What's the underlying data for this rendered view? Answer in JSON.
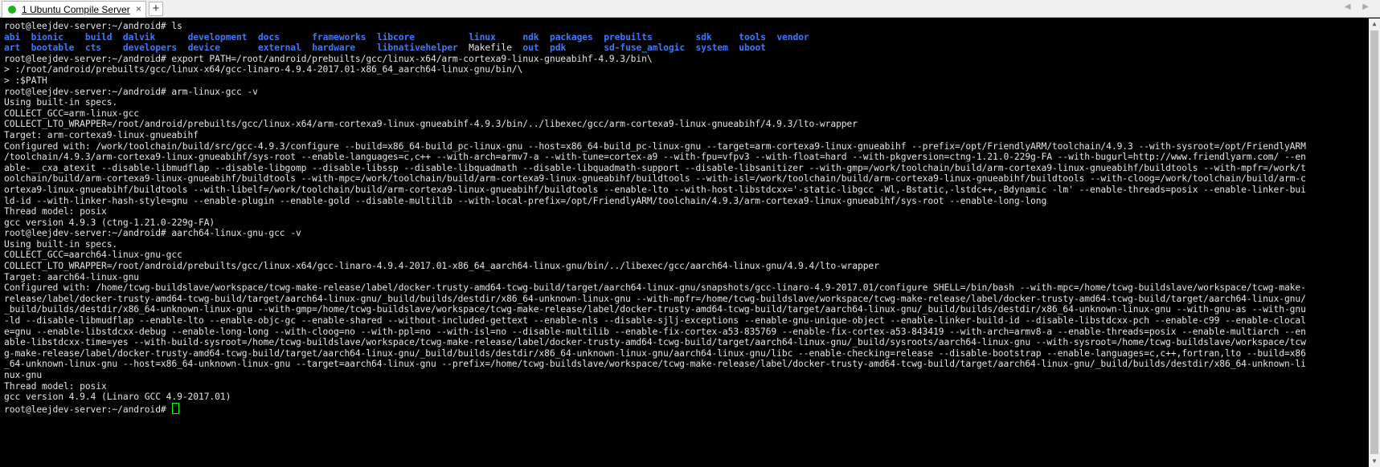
{
  "window": {
    "tab_title": "1 Ubuntu Compile Server",
    "tab_close": "×",
    "new_tab": "+",
    "nav_arrows": "◀ ▶"
  },
  "terminal": {
    "lines": [
      [
        {
          "t": "root@leejdev-server:~/android# ls"
        }
      ],
      [
        {
          "t": "abi",
          "c": "dir"
        },
        {
          "t": "  "
        },
        {
          "t": "bionic",
          "c": "dir"
        },
        {
          "t": "    "
        },
        {
          "t": "build",
          "c": "dir"
        },
        {
          "t": "  "
        },
        {
          "t": "dalvik",
          "c": "dir"
        },
        {
          "t": "      "
        },
        {
          "t": "development",
          "c": "dir"
        },
        {
          "t": "  "
        },
        {
          "t": "docs",
          "c": "dir"
        },
        {
          "t": "      "
        },
        {
          "t": "frameworks",
          "c": "dir"
        },
        {
          "t": "  "
        },
        {
          "t": "libcore",
          "c": "dir"
        },
        {
          "t": "          "
        },
        {
          "t": "linux",
          "c": "dir"
        },
        {
          "t": "     "
        },
        {
          "t": "ndk",
          "c": "dir"
        },
        {
          "t": "  "
        },
        {
          "t": "packages",
          "c": "dir"
        },
        {
          "t": "  "
        },
        {
          "t": "prebuilts",
          "c": "dir"
        },
        {
          "t": "        "
        },
        {
          "t": "sdk",
          "c": "dir"
        },
        {
          "t": "     "
        },
        {
          "t": "tools",
          "c": "dir"
        },
        {
          "t": "  "
        },
        {
          "t": "vendor",
          "c": "dir"
        }
      ],
      [
        {
          "t": "art",
          "c": "dir"
        },
        {
          "t": "  "
        },
        {
          "t": "bootable",
          "c": "dir"
        },
        {
          "t": "  "
        },
        {
          "t": "cts",
          "c": "dir"
        },
        {
          "t": "    "
        },
        {
          "t": "developers",
          "c": "dir"
        },
        {
          "t": "  "
        },
        {
          "t": "device",
          "c": "dir"
        },
        {
          "t": "       "
        },
        {
          "t": "external",
          "c": "dir"
        },
        {
          "t": "  "
        },
        {
          "t": "hardware",
          "c": "dir"
        },
        {
          "t": "    "
        },
        {
          "t": "libnativehelper",
          "c": "dir"
        },
        {
          "t": "  Makefile  "
        },
        {
          "t": "out",
          "c": "dir"
        },
        {
          "t": "  "
        },
        {
          "t": "pdk",
          "c": "dir"
        },
        {
          "t": "       "
        },
        {
          "t": "sd-fuse_amlogic",
          "c": "dir"
        },
        {
          "t": "  "
        },
        {
          "t": "system",
          "c": "dir"
        },
        {
          "t": "  "
        },
        {
          "t": "uboot",
          "c": "dir"
        }
      ],
      [
        {
          "t": "root@leejdev-server:~/android# export PATH=/root/android/prebuilts/gcc/linux-x64/arm-cortexa9-linux-gnueabihf-4.9.3/bin\\"
        }
      ],
      [
        {
          "t": "> :/root/android/prebuilts/gcc/linux-x64/gcc-linaro-4.9.4-2017.01-x86_64_aarch64-linux-gnu/bin/\\"
        }
      ],
      [
        {
          "t": "> :$PATH"
        }
      ],
      [
        {
          "t": "root@leejdev-server:~/android# arm-linux-gcc -v"
        }
      ],
      [
        {
          "t": "Using built-in specs."
        }
      ],
      [
        {
          "t": "COLLECT_GCC=arm-linux-gcc"
        }
      ],
      [
        {
          "t": "COLLECT_LTO_WRAPPER=/root/android/prebuilts/gcc/linux-x64/arm-cortexa9-linux-gnueabihf-4.9.3/bin/../libexec/gcc/arm-cortexa9-linux-gnueabihf/4.9.3/lto-wrapper"
        }
      ],
      [
        {
          "t": "Target: arm-cortexa9-linux-gnueabihf"
        }
      ],
      [
        {
          "t": "Configured with: /work/toolchain/build/src/gcc-4.9.3/configure --build=x86_64-build_pc-linux-gnu --host=x86_64-build_pc-linux-gnu --target=arm-cortexa9-linux-gnueabihf --prefix=/opt/FriendlyARM/toolchain/4.9.3 --with-sysroot=/opt/FriendlyARM"
        }
      ],
      [
        {
          "t": "/toolchain/4.9.3/arm-cortexa9-linux-gnueabihf/sys-root --enable-languages=c,c++ --with-arch=armv7-a --with-tune=cortex-a9 --with-fpu=vfpv3 --with-float=hard --with-pkgversion=ctng-1.21.0-229g-FA --with-bugurl=http://www.friendlyarm.com/ --en"
        }
      ],
      [
        {
          "t": "able-__cxa_atexit --disable-libmudflap --disable-libgomp --disable-libssp --disable-libquadmath --disable-libquadmath-support --disable-libsanitizer --with-gmp=/work/toolchain/build/arm-cortexa9-linux-gnueabihf/buildtools --with-mpfr=/work/t"
        }
      ],
      [
        {
          "t": "oolchain/build/arm-cortexa9-linux-gnueabihf/buildtools --with-mpc=/work/toolchain/build/arm-cortexa9-linux-gnueabihf/buildtools --with-isl=/work/toolchain/build/arm-cortexa9-linux-gnueabihf/buildtools --with-cloog=/work/toolchain/build/arm-c"
        }
      ],
      [
        {
          "t": "ortexa9-linux-gnueabihf/buildtools --with-libelf=/work/toolchain/build/arm-cortexa9-linux-gnueabihf/buildtools --enable-lto --with-host-libstdcxx='-static-libgcc -Wl,-Bstatic,-lstdc++,-Bdynamic -lm' --enable-threads=posix --enable-linker-bui"
        }
      ],
      [
        {
          "t": "ld-id --with-linker-hash-style=gnu --enable-plugin --enable-gold --disable-multilib --with-local-prefix=/opt/FriendlyARM/toolchain/4.9.3/arm-cortexa9-linux-gnueabihf/sys-root --enable-long-long"
        }
      ],
      [
        {
          "t": "Thread model: posix"
        }
      ],
      [
        {
          "t": "gcc version 4.9.3 (ctng-1.21.0-229g-FA)"
        }
      ],
      [
        {
          "t": "root@leejdev-server:~/android# aarch64-linux-gnu-gcc -v"
        }
      ],
      [
        {
          "t": "Using built-in specs."
        }
      ],
      [
        {
          "t": "COLLECT_GCC=aarch64-linux-gnu-gcc"
        }
      ],
      [
        {
          "t": "COLLECT_LTO_WRAPPER=/root/android/prebuilts/gcc/linux-x64/gcc-linaro-4.9.4-2017.01-x86_64_aarch64-linux-gnu/bin/../libexec/gcc/aarch64-linux-gnu/4.9.4/lto-wrapper"
        }
      ],
      [
        {
          "t": "Target: aarch64-linux-gnu"
        }
      ],
      [
        {
          "t": "Configured with: /home/tcwg-buildslave/workspace/tcwg-make-release/label/docker-trusty-amd64-tcwg-build/target/aarch64-linux-gnu/snapshots/gcc-linaro-4.9-2017.01/configure SHELL=/bin/bash --with-mpc=/home/tcwg-buildslave/workspace/tcwg-make-"
        }
      ],
      [
        {
          "t": "release/label/docker-trusty-amd64-tcwg-build/target/aarch64-linux-gnu/_build/builds/destdir/x86_64-unknown-linux-gnu --with-mpfr=/home/tcwg-buildslave/workspace/tcwg-make-release/label/docker-trusty-amd64-tcwg-build/target/aarch64-linux-gnu/"
        }
      ],
      [
        {
          "t": "_build/builds/destdir/x86_64-unknown-linux-gnu --with-gmp=/home/tcwg-buildslave/workspace/tcwg-make-release/label/docker-trusty-amd64-tcwg-build/target/aarch64-linux-gnu/_build/builds/destdir/x86_64-unknown-linux-gnu --with-gnu-as --with-gnu"
        }
      ],
      [
        {
          "t": "-ld --disable-libmudflap --enable-lto --enable-objc-gc --enable-shared --without-included-gettext --enable-nls --disable-sjlj-exceptions --enable-gnu-unique-object --enable-linker-build-id --disable-libstdcxx-pch --enable-c99 --enable-clocal"
        }
      ],
      [
        {
          "t": "e=gnu --enable-libstdcxx-debug --enable-long-long --with-cloog=no --with-ppl=no --with-isl=no --disable-multilib --enable-fix-cortex-a53-835769 --enable-fix-cortex-a53-843419 --with-arch=armv8-a --enable-threads=posix --enable-multiarch --en"
        }
      ],
      [
        {
          "t": "able-libstdcxx-time=yes --with-build-sysroot=/home/tcwg-buildslave/workspace/tcwg-make-release/label/docker-trusty-amd64-tcwg-build/target/aarch64-linux-gnu/_build/sysroots/aarch64-linux-gnu --with-sysroot=/home/tcwg-buildslave/workspace/tcw"
        }
      ],
      [
        {
          "t": "g-make-release/label/docker-trusty-amd64-tcwg-build/target/aarch64-linux-gnu/_build/builds/destdir/x86_64-unknown-linux-gnu/aarch64-linux-gnu/libc --enable-checking=release --disable-bootstrap --enable-languages=c,c++,fortran,lto --build=x86"
        }
      ],
      [
        {
          "t": "_64-unknown-linux-gnu --host=x86_64-unknown-linux-gnu --target=aarch64-linux-gnu --prefix=/home/tcwg-buildslave/workspace/tcwg-make-release/label/docker-trusty-amd64-tcwg-build/target/aarch64-linux-gnu/_build/builds/destdir/x86_64-unknown-li"
        }
      ],
      [
        {
          "t": "nux-gnu"
        }
      ],
      [
        {
          "t": "Thread model: posix"
        }
      ],
      [
        {
          "t": "gcc version 4.9.4 (Linaro GCC 4.9-2017.01)"
        }
      ],
      [
        {
          "t": "root@leejdev-server:~/android# "
        }
      ]
    ]
  },
  "colors": {
    "background": "#000000",
    "text": "#e5e5e5",
    "directory": "#3b78ff",
    "cursor": "#00ff00",
    "tab_status": "#1db31d"
  }
}
